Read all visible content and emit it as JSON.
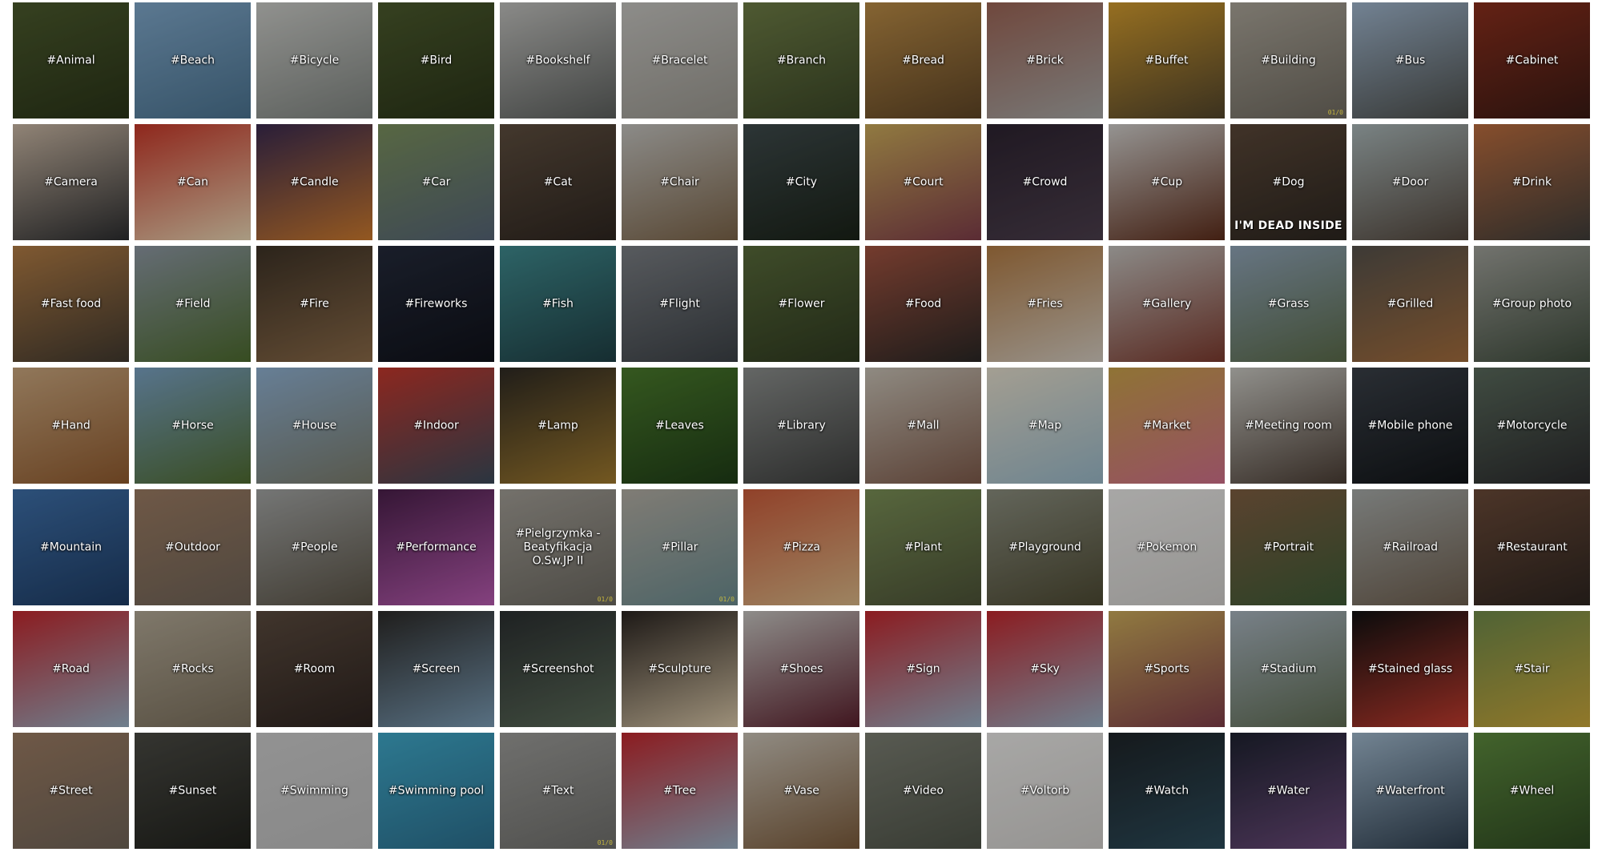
{
  "gallery": {
    "tiles": [
      {
        "label": "#Animal",
        "colors": [
          "#4b5a2d",
          "#2a3418"
        ]
      },
      {
        "label": "#Beach",
        "colors": [
          "#7fa7c9",
          "#4b7390"
        ]
      },
      {
        "label": "#Bicycle",
        "colors": [
          "#c9cac6",
          "#7f8480"
        ]
      },
      {
        "label": "#Bird",
        "colors": [
          "#4b5a2d",
          "#2a3418"
        ]
      },
      {
        "label": "#Bookshelf",
        "colors": [
          "#c0c0bd",
          "#5c5f5d"
        ]
      },
      {
        "label": "#Bracelet",
        "colors": [
          "#c4c3bf",
          "#9a978f"
        ]
      },
      {
        "label": "#Branch",
        "colors": [
          "#6e7d46",
          "#3b4727"
        ]
      },
      {
        "label": "#Bread",
        "colors": [
          "#b98b46",
          "#5f4526"
        ]
      },
      {
        "label": "#Brick",
        "colors": [
          "#9b6455",
          "#a7a7a5"
        ]
      },
      {
        "label": "#Buffet",
        "colors": [
          "#d09a2e",
          "#52452c"
        ]
      },
      {
        "label": "#Building",
        "colors": [
          "#aaa498",
          "#6f6a60"
        ],
        "corner": "01/0"
      },
      {
        "label": "#Bus",
        "colors": [
          "#9fb5cc",
          "#4d4f4c"
        ]
      },
      {
        "label": "#Cabinet",
        "colors": [
          "#8b2f1d",
          "#3a1a14"
        ]
      },
      {
        "label": "#Camera",
        "colors": [
          "#c9b7a4",
          "#2c2d2f"
        ]
      },
      {
        "label": "#Can",
        "colors": [
          "#c63728",
          "#e9d6b4"
        ]
      },
      {
        "label": "#Candle",
        "colors": [
          "#3a2a4f",
          "#cc7a2e"
        ]
      },
      {
        "label": "#Car",
        "colors": [
          "#7a8f5d",
          "#556476"
        ]
      },
      {
        "label": "#Cat",
        "colors": [
          "#5e4e3f",
          "#2e2620"
        ]
      },
      {
        "label": "#Chair",
        "colors": [
          "#c2c1bd",
          "#7a6348"
        ]
      },
      {
        "label": "#City",
        "colors": [
          "#3e4a4b",
          "#1a2218"
        ]
      },
      {
        "label": "#Court",
        "colors": [
          "#c9a95a",
          "#7e3d49"
        ]
      },
      {
        "label": "#Crowd",
        "colors": [
          "#2d2330",
          "#4b3e4c"
        ]
      },
      {
        "label": "#Cup",
        "colors": [
          "#cfcdca",
          "#5c2c1a"
        ]
      },
      {
        "label": "#Dog",
        "colors": [
          "#5a4738",
          "#2c2620"
        ],
        "meme": "I'M DEAD INSIDE"
      },
      {
        "label": "#Door",
        "colors": [
          "#a9b6b7",
          "#52463c"
        ]
      },
      {
        "label": "#Drink",
        "colors": [
          "#bb6d3f",
          "#3f3d3a"
        ]
      },
      {
        "label": "#Fast food",
        "colors": [
          "#b17c45",
          "#41392f"
        ]
      },
      {
        "label": "#Field",
        "colors": [
          "#8d97a2",
          "#4c6a2e"
        ]
      },
      {
        "label": "#Fire",
        "colors": [
          "#3d3226",
          "#8a6a48"
        ]
      },
      {
        "label": "#Fireworks",
        "colors": [
          "#242a3a",
          "#0f1119"
        ]
      },
      {
        "label": "#Fish",
        "colors": [
          "#3f8a8e",
          "#1f3f44"
        ]
      },
      {
        "label": "#Flight",
        "colors": [
          "#7a7e83",
          "#3c4146"
        ]
      },
      {
        "label": "#Flower",
        "colors": [
          "#586a3a",
          "#2f3a20"
        ]
      },
      {
        "label": "#Food",
        "colors": [
          "#a15340",
          "#2a2725"
        ]
      },
      {
        "label": "#Fries",
        "colors": [
          "#b07a43",
          "#d3cbc0"
        ]
      },
      {
        "label": "#Gallery",
        "colors": [
          "#c2c0bc",
          "#7b3a2e"
        ]
      },
      {
        "label": "#Grass",
        "colors": [
          "#8fa3b6",
          "#5a6a49"
        ]
      },
      {
        "label": "#Grilled",
        "colors": [
          "#55514b",
          "#a26c3c"
        ]
      },
      {
        "label": "#Group photo",
        "colors": [
          "#9fa099",
          "#3e4b3c"
        ]
      },
      {
        "label": "#Hand",
        "colors": [
          "#c9a67e",
          "#8f5a2e"
        ]
      },
      {
        "label": "#Horse",
        "colors": [
          "#7aa1c2",
          "#4f6b30"
        ]
      },
      {
        "label": "#House",
        "colors": [
          "#8fb0d0",
          "#7a7b6b"
        ]
      },
      {
        "label": "#Indoor",
        "colors": [
          "#c2372c",
          "#3b4a5a"
        ]
      },
      {
        "label": "#Lamp",
        "colors": [
          "#2e2a23",
          "#a07a2e"
        ]
      },
      {
        "label": "#Leaves",
        "colors": [
          "#4a7a2c",
          "#1f3d17"
        ]
      },
      {
        "label": "#Library",
        "colors": [
          "#8b8e8c",
          "#3d3e3d"
        ]
      },
      {
        "label": "#Mall",
        "colors": [
          "#c7c0b4",
          "#7d5a4a"
        ]
      },
      {
        "label": "#Map",
        "colors": [
          "#e3dccb",
          "#98b7c7"
        ]
      },
      {
        "label": "#Market",
        "colors": [
          "#c7a04a",
          "#cf6f8a"
        ]
      },
      {
        "label": "#Meeting room",
        "colors": [
          "#c9c8c2",
          "#4a3d34"
        ]
      },
      {
        "label": "#Mobile phone",
        "colors": [
          "#3a4048",
          "#111417"
        ]
      },
      {
        "label": "#Motorcycle",
        "colors": [
          "#5a6a5c",
          "#2a2a2c"
        ]
      },
      {
        "label": "#Mountain",
        "colors": [
          "#3e6fa8",
          "#1e3c64"
        ]
      },
      {
        "label": "#Outdoor",
        "colors": [
          "#9a7b62",
          "#6f6357"
        ]
      },
      {
        "label": "#People",
        "colors": [
          "#a2a4a3",
          "#5a5346"
        ]
      },
      {
        "label": "#Performance",
        "colors": [
          "#4a1f4a",
          "#b85bb0"
        ]
      },
      {
        "label": "#Pielgrzymka - Beatyfikacja O.Sw.JP II",
        "colors": [
          "#a19d95",
          "#6c6961"
        ],
        "corner": "01/0"
      },
      {
        "label": "#Pillar",
        "colors": [
          "#b2ada3",
          "#6a8a8e"
        ],
        "corner": "01/0"
      },
      {
        "label": "#Pizza",
        "colors": [
          "#c95b3a",
          "#d9b787"
        ]
      },
      {
        "label": "#Plant",
        "colors": [
          "#7a8f56",
          "#4c5237"
        ]
      },
      {
        "label": "#Playground",
        "colors": [
          "#8a8d7e",
          "#4d4a33"
        ]
      },
      {
        "label": "#Pokemon",
        "colors": [
          "#e9e8e6",
          "#cfcdca"
        ]
      },
      {
        "label": "#Portrait",
        "colors": [
          "#7e5d42",
          "#3e5b36"
        ]
      },
      {
        "label": "#Railroad",
        "colors": [
          "#a6aaa8",
          "#6d5e4e"
        ]
      },
      {
        "label": "#Restaurant",
        "colors": [
          "#6a4a38",
          "#2e2520"
        ]
      },
      {
        "label": "#Road",
        "colors": [
          "#c1272d",
          "#9ab1c5"
        ]
      },
      {
        "label": "#Rocks",
        "colors": [
          "#b1a794",
          "#7a6f5c"
        ]
      },
      {
        "label": "#Room",
        "colors": [
          "#5a4a3e",
          "#2e2420"
        ]
      },
      {
        "label": "#Screen",
        "colors": [
          "#2c2a28",
          "#7a9bb4"
        ]
      },
      {
        "label": "#Screenshot",
        "colors": [
          "#2b2f30",
          "#5a6a58"
        ]
      },
      {
        "label": "#Sculpture",
        "colors": [
          "#2a2420",
          "#d9c7a8"
        ]
      },
      {
        "label": "#Shoes",
        "colors": [
          "#c5c3bf",
          "#5a1f2c"
        ]
      },
      {
        "label": "#Sign",
        "colors": [
          "#c1272d",
          "#9ab1c5"
        ]
      },
      {
        "label": "#Sky",
        "colors": [
          "#c1272d",
          "#9ab1c5"
        ]
      },
      {
        "label": "#Sports",
        "colors": [
          "#c9a95a",
          "#7e3d49"
        ]
      },
      {
        "label": "#Stadium",
        "colors": [
          "#a7b3bd",
          "#5e6b52"
        ]
      },
      {
        "label": "#Stained glass",
        "colors": [
          "#111111",
          "#c23b2e"
        ]
      },
      {
        "label": "#Stair",
        "colors": [
          "#6f8a4a",
          "#c9a63a"
        ]
      },
      {
        "label": "#Street",
        "colors": [
          "#9a7b62",
          "#6f6357"
        ]
      },
      {
        "label": "#Sunset",
        "colors": [
          "#4a4a44",
          "#20211c"
        ]
      },
      {
        "label": "#Swimming",
        "colors": [
          "#cbcbcb",
          "#bdbdbd"
        ]
      },
      {
        "label": "#Swimming pool",
        "colors": [
          "#3fa7c7",
          "#2c6f8e"
        ]
      },
      {
        "label": "#Text",
        "colors": [
          "#9b9b98",
          "#6f6f6c"
        ],
        "corner": "01/0"
      },
      {
        "label": "#Tree",
        "colors": [
          "#c1272d",
          "#9ab1c5"
        ]
      },
      {
        "label": "#Vase",
        "colors": [
          "#c9c2b6",
          "#7a5a3a"
        ]
      },
      {
        "label": "#Video",
        "colors": [
          "#7b7e72",
          "#4e5348"
        ]
      },
      {
        "label": "#Voltorb",
        "colors": [
          "#e9e8e6",
          "#cfcdca"
        ]
      },
      {
        "label": "#Watch",
        "colors": [
          "#1e2428",
          "#2c4b5a"
        ]
      },
      {
        "label": "#Water",
        "colors": [
          "#1e2230",
          "#6a4a7a"
        ]
      },
      {
        "label": "#Waterfront",
        "colors": [
          "#9fb7cb",
          "#2e3e4e"
        ]
      },
      {
        "label": "#Wheel",
        "colors": [
          "#5d8a3e",
          "#2f4a22"
        ]
      }
    ]
  }
}
